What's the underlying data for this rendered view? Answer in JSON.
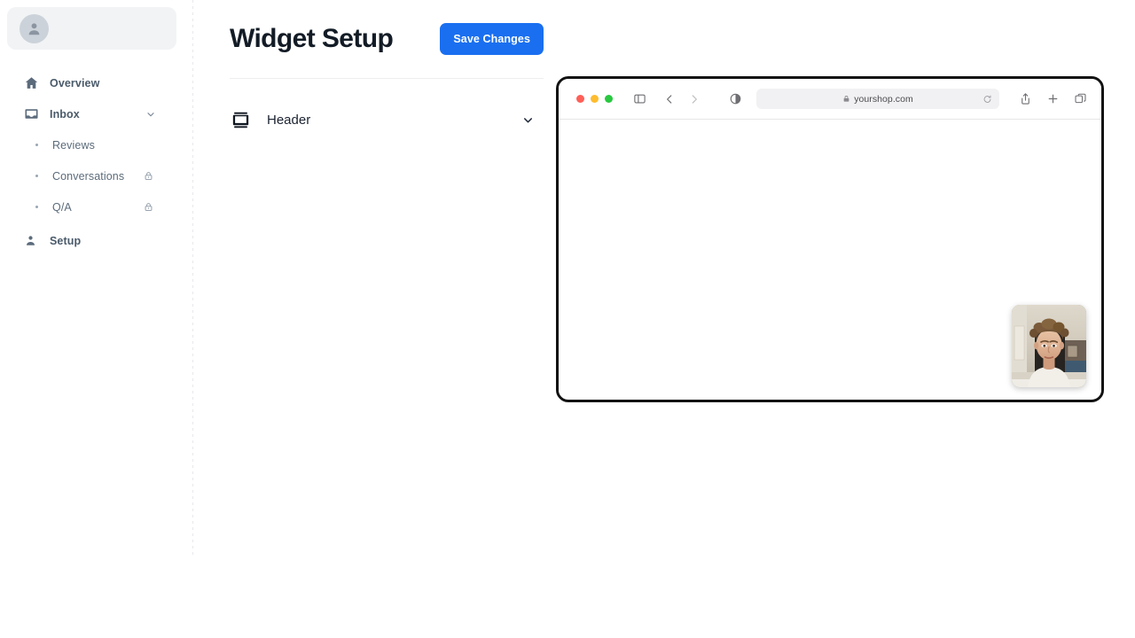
{
  "sidebar": {
    "account": {
      "avatar_icon": "user-avatar-icon"
    },
    "items": [
      {
        "label": "Overview",
        "icon": "home-icon",
        "type": "item"
      },
      {
        "label": "Inbox",
        "icon": "inbox-icon",
        "type": "item",
        "chevron": "chevron-down-icon"
      },
      {
        "label": "Reviews",
        "icon": "bullet-icon",
        "type": "sub"
      },
      {
        "label": "Conversations",
        "icon": "bullet-icon",
        "type": "sub",
        "badge": "lock-icon"
      },
      {
        "label": "Q/A",
        "icon": "bullet-icon",
        "type": "sub",
        "badge": "lock-icon"
      },
      {
        "label": "Setup",
        "icon": "person-icon",
        "type": "item"
      }
    ]
  },
  "main": {
    "title": "Widget Setup",
    "save_label": "Save Changes",
    "sections": [
      {
        "label": "Header",
        "icon": "contact-card-icon",
        "chevron": "chevron-down-icon",
        "expanded": false
      }
    ]
  },
  "preview": {
    "browser": {
      "traffic_lights": [
        "close-red",
        "minimize-yellow",
        "zoom-green"
      ],
      "sidebar_toggle_icon": "sidebar-toggle-icon",
      "back_icon": "chevron-left-icon",
      "forward_icon": "chevron-right-icon",
      "reader_icon": "reader-contrast-icon",
      "url": "yourshop.com",
      "url_lock_icon": "lock-icon",
      "reload_icon": "reload-icon",
      "share_icon": "share-icon",
      "new_tab_icon": "plus-icon",
      "tab_overview_icon": "tab-overview-icon"
    },
    "webcam": {
      "label": "webcam-preview"
    }
  },
  "colors": {
    "accent_blue": "#1a6ff0",
    "sidebar_text": "#4a5a6a",
    "title_text": "#131c26",
    "browser_border": "#121212",
    "traffic_red": "#ff5f57",
    "traffic_yellow": "#febc2e",
    "traffic_green": "#28c840",
    "urlbar_bg": "#f1f1f3",
    "account_bg": "#f1f3f5"
  }
}
